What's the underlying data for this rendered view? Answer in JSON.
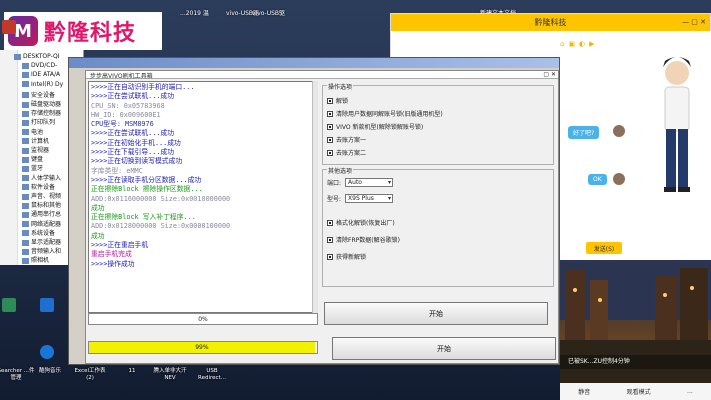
{
  "logo": {
    "text": "黔隆科技"
  },
  "desktop_top_labels": [
    "ADO..",
    "tools",
    "...2019 温",
    "vivo-USB驱",
    "vivo-USB驱",
    "新建文本文档"
  ],
  "explorer": {
    "items": [
      "DESKTOP-QI",
      "DVD/CD-",
      "IDE ATA/A",
      "Intel(R) Dy",
      "安全设备",
      "磁盘驱动器",
      "存储控制器",
      "打印队列",
      "电池",
      "计算机",
      "监视器",
      "键盘",
      "蓝牙",
      "人体学输入",
      "软件设备",
      "声音、视频",
      "鼠标和其他",
      "通用串行总",
      "网络适配器",
      "系统设备",
      "显示适配器",
      "音频输入和",
      "照相机"
    ]
  },
  "tool": {
    "title": "步步高VIVO刷机工具箱",
    "log": [
      {
        "text": ">>>>正在自动识别手机的端口...",
        "color": "blue"
      },
      {
        "text": ">>>>正在尝试联机...成功",
        "color": "blue"
      },
      {
        "text": "    CPU_SN: 0x05783968",
        "color": "gray"
      },
      {
        "text": "    HW_ID:  0x009600E1",
        "color": "gray"
      },
      {
        "text": "    CPU型号: MSM8976",
        "color": "dblue"
      },
      {
        "text": ">>>>正在尝试联机...成功",
        "color": "blue"
      },
      {
        "text": ">>>>正在初始化手机...成功",
        "color": "blue"
      },
      {
        "text": ">>>>正在下载引导...成功",
        "color": "blue"
      },
      {
        "text": ">>>>正在切换到读写模式成功",
        "color": "blue"
      },
      {
        "text": "      字库类型: eMMC",
        "color": "gray"
      },
      {
        "text": ">>>>正在读取手机分区数据...成功",
        "color": "blue"
      },
      {
        "text": "    正在擦除Block  擦除操作区数据...",
        "color": "green"
      },
      {
        "text": "    ADD:0x0116000000   Size:0x0010000000",
        "color": "gray"
      },
      {
        "text": "成功",
        "color": "green"
      },
      {
        "text": "    正在擦除Block  写入补丁程序...",
        "color": "green"
      },
      {
        "text": "    ADD:0x0128000000   Size:0x0000100000",
        "color": "gray"
      },
      {
        "text": "成功",
        "color": "green"
      },
      {
        "text": ">>>>正在重启手机",
        "color": "blue"
      },
      {
        "text": "      重启手机完成",
        "color": "mag"
      },
      {
        "text": ">>>>操作成功",
        "color": "blue"
      }
    ],
    "ops_group_title": "操作选项",
    "ops": [
      {
        "label": "解锁",
        "checked": true
      },
      {
        "label": "清除用户数据同解账号锁(旧版通用机型)",
        "checked": true
      },
      {
        "label": "VIVO 新款机型(解除锁解账号锁)",
        "checked": true
      },
      {
        "label": "去账方案一",
        "checked": true
      },
      {
        "label": "去账方案二",
        "checked": true
      }
    ],
    "other_group_title": "其他选项",
    "port_label": "端口:",
    "port_value": "Auto",
    "model_label": "型号:",
    "model_value": "X9S Plus",
    "other_opts": [
      {
        "label": "格式化解锁(恢复出厂)",
        "checked": true
      },
      {
        "label": "清除FRP数据(解谷歌锁)",
        "checked": true
      },
      {
        "label": "获得新解锁",
        "checked": true
      }
    ],
    "progress1": "0%",
    "start1": "开始",
    "progress2": "99%",
    "progress2_fraction": 0.99,
    "start2": "开始"
  },
  "chat": {
    "title": "黔隆科技",
    "bubble1": "好了吧?",
    "bubble2": "OK",
    "send": "发送(S)",
    "notice": "已被SK...ZU控制4分钟",
    "bottom": [
      "静音",
      "观看模式",
      "..."
    ]
  },
  "desktop_bottom_labels": [
    "Searcher\n...件管理",
    "酷狗音乐",
    "Excel工作表\n(2)",
    "11",
    "腾入单非大汗\nNEV",
    "USB\nRedirect..."
  ]
}
